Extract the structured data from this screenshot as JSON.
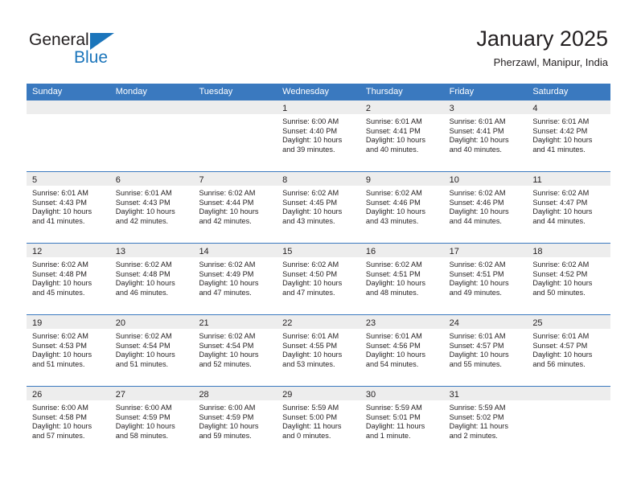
{
  "brand": {
    "name_top": "General",
    "name_bottom": "Blue",
    "triangle_icon": "triangle-icon",
    "color_primary": "#1b75bb",
    "color_text": "#231f20"
  },
  "header": {
    "title": "January 2025",
    "subtitle": "Pherzawl, Manipur, India"
  },
  "theme": {
    "header_bar": "#3a79bf",
    "day_band": "#ededed",
    "text": "#231f20",
    "page_background": "#ffffff"
  },
  "weekdays": [
    "Sunday",
    "Monday",
    "Tuesday",
    "Wednesday",
    "Thursday",
    "Friday",
    "Saturday"
  ],
  "weeks": [
    [
      {
        "day": "",
        "lines": []
      },
      {
        "day": "",
        "lines": []
      },
      {
        "day": "",
        "lines": []
      },
      {
        "day": "1",
        "lines": [
          "Sunrise: 6:00 AM",
          "Sunset: 4:40 PM",
          "Daylight: 10 hours",
          "and 39 minutes."
        ]
      },
      {
        "day": "2",
        "lines": [
          "Sunrise: 6:01 AM",
          "Sunset: 4:41 PM",
          "Daylight: 10 hours",
          "and 40 minutes."
        ]
      },
      {
        "day": "3",
        "lines": [
          "Sunrise: 6:01 AM",
          "Sunset: 4:41 PM",
          "Daylight: 10 hours",
          "and 40 minutes."
        ]
      },
      {
        "day": "4",
        "lines": [
          "Sunrise: 6:01 AM",
          "Sunset: 4:42 PM",
          "Daylight: 10 hours",
          "and 41 minutes."
        ]
      }
    ],
    [
      {
        "day": "5",
        "lines": [
          "Sunrise: 6:01 AM",
          "Sunset: 4:43 PM",
          "Daylight: 10 hours",
          "and 41 minutes."
        ]
      },
      {
        "day": "6",
        "lines": [
          "Sunrise: 6:01 AM",
          "Sunset: 4:43 PM",
          "Daylight: 10 hours",
          "and 42 minutes."
        ]
      },
      {
        "day": "7",
        "lines": [
          "Sunrise: 6:02 AM",
          "Sunset: 4:44 PM",
          "Daylight: 10 hours",
          "and 42 minutes."
        ]
      },
      {
        "day": "8",
        "lines": [
          "Sunrise: 6:02 AM",
          "Sunset: 4:45 PM",
          "Daylight: 10 hours",
          "and 43 minutes."
        ]
      },
      {
        "day": "9",
        "lines": [
          "Sunrise: 6:02 AM",
          "Sunset: 4:46 PM",
          "Daylight: 10 hours",
          "and 43 minutes."
        ]
      },
      {
        "day": "10",
        "lines": [
          "Sunrise: 6:02 AM",
          "Sunset: 4:46 PM",
          "Daylight: 10 hours",
          "and 44 minutes."
        ]
      },
      {
        "day": "11",
        "lines": [
          "Sunrise: 6:02 AM",
          "Sunset: 4:47 PM",
          "Daylight: 10 hours",
          "and 44 minutes."
        ]
      }
    ],
    [
      {
        "day": "12",
        "lines": [
          "Sunrise: 6:02 AM",
          "Sunset: 4:48 PM",
          "Daylight: 10 hours",
          "and 45 minutes."
        ]
      },
      {
        "day": "13",
        "lines": [
          "Sunrise: 6:02 AM",
          "Sunset: 4:48 PM",
          "Daylight: 10 hours",
          "and 46 minutes."
        ]
      },
      {
        "day": "14",
        "lines": [
          "Sunrise: 6:02 AM",
          "Sunset: 4:49 PM",
          "Daylight: 10 hours",
          "and 47 minutes."
        ]
      },
      {
        "day": "15",
        "lines": [
          "Sunrise: 6:02 AM",
          "Sunset: 4:50 PM",
          "Daylight: 10 hours",
          "and 47 minutes."
        ]
      },
      {
        "day": "16",
        "lines": [
          "Sunrise: 6:02 AM",
          "Sunset: 4:51 PM",
          "Daylight: 10 hours",
          "and 48 minutes."
        ]
      },
      {
        "day": "17",
        "lines": [
          "Sunrise: 6:02 AM",
          "Sunset: 4:51 PM",
          "Daylight: 10 hours",
          "and 49 minutes."
        ]
      },
      {
        "day": "18",
        "lines": [
          "Sunrise: 6:02 AM",
          "Sunset: 4:52 PM",
          "Daylight: 10 hours",
          "and 50 minutes."
        ]
      }
    ],
    [
      {
        "day": "19",
        "lines": [
          "Sunrise: 6:02 AM",
          "Sunset: 4:53 PM",
          "Daylight: 10 hours",
          "and 51 minutes."
        ]
      },
      {
        "day": "20",
        "lines": [
          "Sunrise: 6:02 AM",
          "Sunset: 4:54 PM",
          "Daylight: 10 hours",
          "and 51 minutes."
        ]
      },
      {
        "day": "21",
        "lines": [
          "Sunrise: 6:02 AM",
          "Sunset: 4:54 PM",
          "Daylight: 10 hours",
          "and 52 minutes."
        ]
      },
      {
        "day": "22",
        "lines": [
          "Sunrise: 6:01 AM",
          "Sunset: 4:55 PM",
          "Daylight: 10 hours",
          "and 53 minutes."
        ]
      },
      {
        "day": "23",
        "lines": [
          "Sunrise: 6:01 AM",
          "Sunset: 4:56 PM",
          "Daylight: 10 hours",
          "and 54 minutes."
        ]
      },
      {
        "day": "24",
        "lines": [
          "Sunrise: 6:01 AM",
          "Sunset: 4:57 PM",
          "Daylight: 10 hours",
          "and 55 minutes."
        ]
      },
      {
        "day": "25",
        "lines": [
          "Sunrise: 6:01 AM",
          "Sunset: 4:57 PM",
          "Daylight: 10 hours",
          "and 56 minutes."
        ]
      }
    ],
    [
      {
        "day": "26",
        "lines": [
          "Sunrise: 6:00 AM",
          "Sunset: 4:58 PM",
          "Daylight: 10 hours",
          "and 57 minutes."
        ]
      },
      {
        "day": "27",
        "lines": [
          "Sunrise: 6:00 AM",
          "Sunset: 4:59 PM",
          "Daylight: 10 hours",
          "and 58 minutes."
        ]
      },
      {
        "day": "28",
        "lines": [
          "Sunrise: 6:00 AM",
          "Sunset: 4:59 PM",
          "Daylight: 10 hours",
          "and 59 minutes."
        ]
      },
      {
        "day": "29",
        "lines": [
          "Sunrise: 5:59 AM",
          "Sunset: 5:00 PM",
          "Daylight: 11 hours",
          "and 0 minutes."
        ]
      },
      {
        "day": "30",
        "lines": [
          "Sunrise: 5:59 AM",
          "Sunset: 5:01 PM",
          "Daylight: 11 hours",
          "and 1 minute."
        ]
      },
      {
        "day": "31",
        "lines": [
          "Sunrise: 5:59 AM",
          "Sunset: 5:02 PM",
          "Daylight: 11 hours",
          "and 2 minutes."
        ]
      },
      {
        "day": "",
        "lines": []
      }
    ]
  ]
}
